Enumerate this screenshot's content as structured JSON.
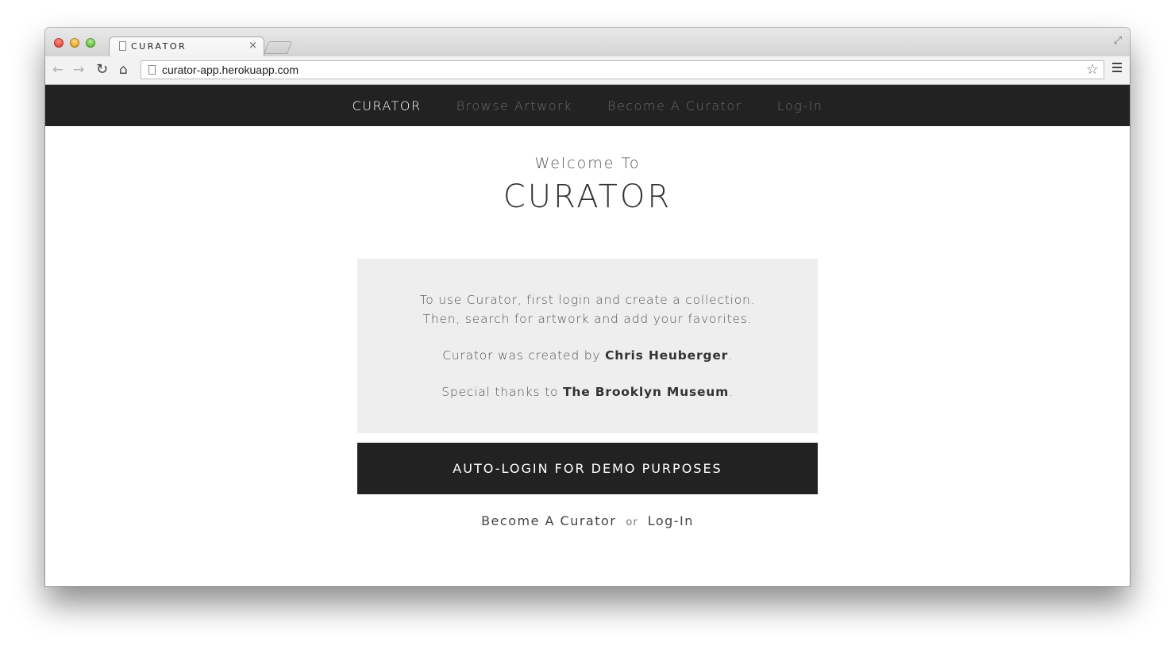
{
  "browser": {
    "tab_title": "CURATOR",
    "tab_close": "×",
    "url": "curator-app.herokuapp.com",
    "back_icon": "arrow-left",
    "forward_icon": "arrow-right",
    "reload_icon": "reload",
    "home_icon": "home",
    "star_icon": "star",
    "menu_icon": "hamburger",
    "fullscreen_icon": "expand"
  },
  "nav": {
    "brand": "CURATOR",
    "items": [
      {
        "label": "Browse Artwork"
      },
      {
        "label": "Become A Curator"
      },
      {
        "label": "Log-In"
      }
    ]
  },
  "hero": {
    "welcome": "Welcome To",
    "title": "CURATOR"
  },
  "info": {
    "line1": "To use Curator, first login and create a collection.",
    "line2": "Then, search for artwork and add your favorites.",
    "created_prefix": "Curator was created by ",
    "created_name": "Chris Heuberger",
    "created_suffix": ".",
    "thanks_prefix": "Special thanks to ",
    "thanks_name": "The Brooklyn Museum",
    "thanks_suffix": "."
  },
  "demo_button": "AUTO-LOGIN FOR DEMO PURPOSES",
  "footer": {
    "become_curator": "Become A Curator",
    "or": "or",
    "login": "Log-In"
  }
}
